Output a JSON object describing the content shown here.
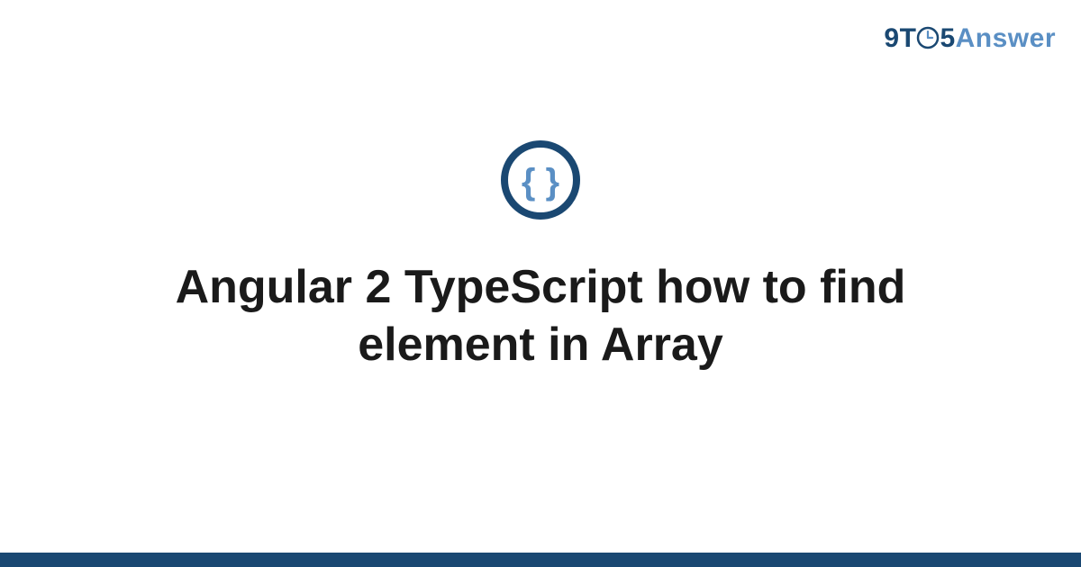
{
  "logo": {
    "part1": "9T",
    "part2": "5",
    "part3": "Answer"
  },
  "icon": {
    "name": "braces-icon"
  },
  "title": "Angular 2 TypeScript how to find element in Array",
  "colors": {
    "dark_blue": "#1a4872",
    "light_blue": "#5a8fc4"
  }
}
